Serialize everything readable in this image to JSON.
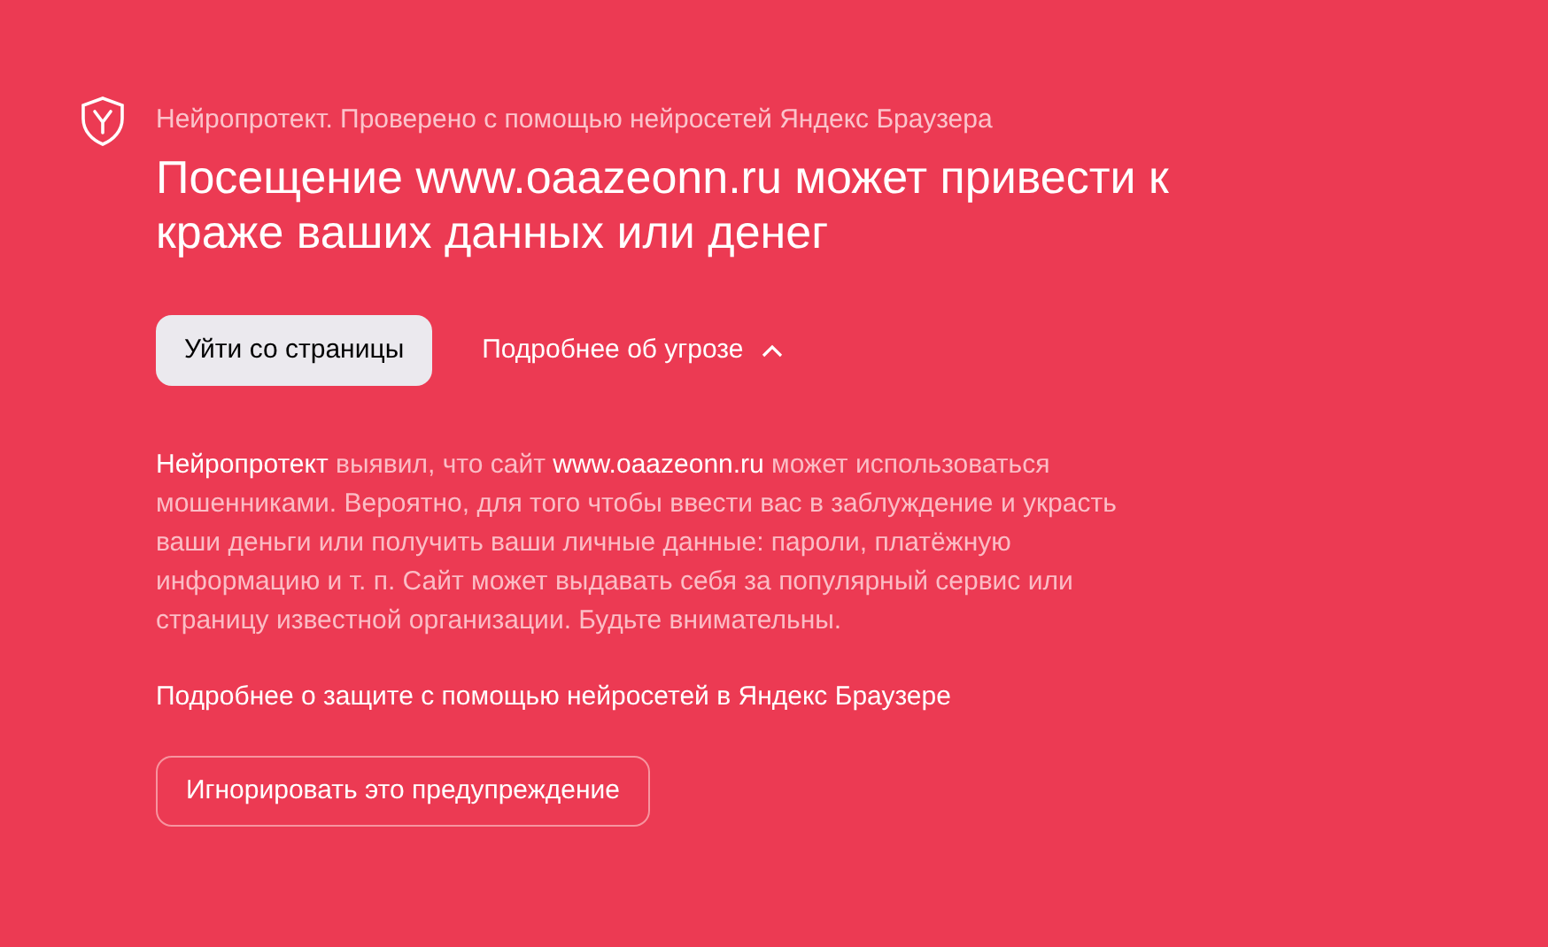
{
  "header": {
    "text": "Нейропротект. Проверено с помощью нейросетей Яндекс Браузера"
  },
  "title": "Посещение www.oaazeonn.ru может привести к краже ваших данных или денег",
  "actions": {
    "leave_button": "Уйти со страницы",
    "details_toggle": {
      "label": "Подробнее об угрозе",
      "expanded": true
    }
  },
  "details": {
    "paragraph": "**Нейропротект** выявил, что сайт **www.oaazeonn.ru** может использоваться мошенниками. Вероятно, для того чтобы ввести вас в заблуждение и украсть ваши деньги или получить ваши личные данные: пароли, платёжную информацию и т. п. Сайт может выдавать себя за популярный сервис или страницу известной организации. Будьте внимательны.",
    "link": "Подробнее о защите с помощью нейросетей в Яндекс Браузере",
    "ignore_button": "Игнорировать это предупреждение"
  }
}
